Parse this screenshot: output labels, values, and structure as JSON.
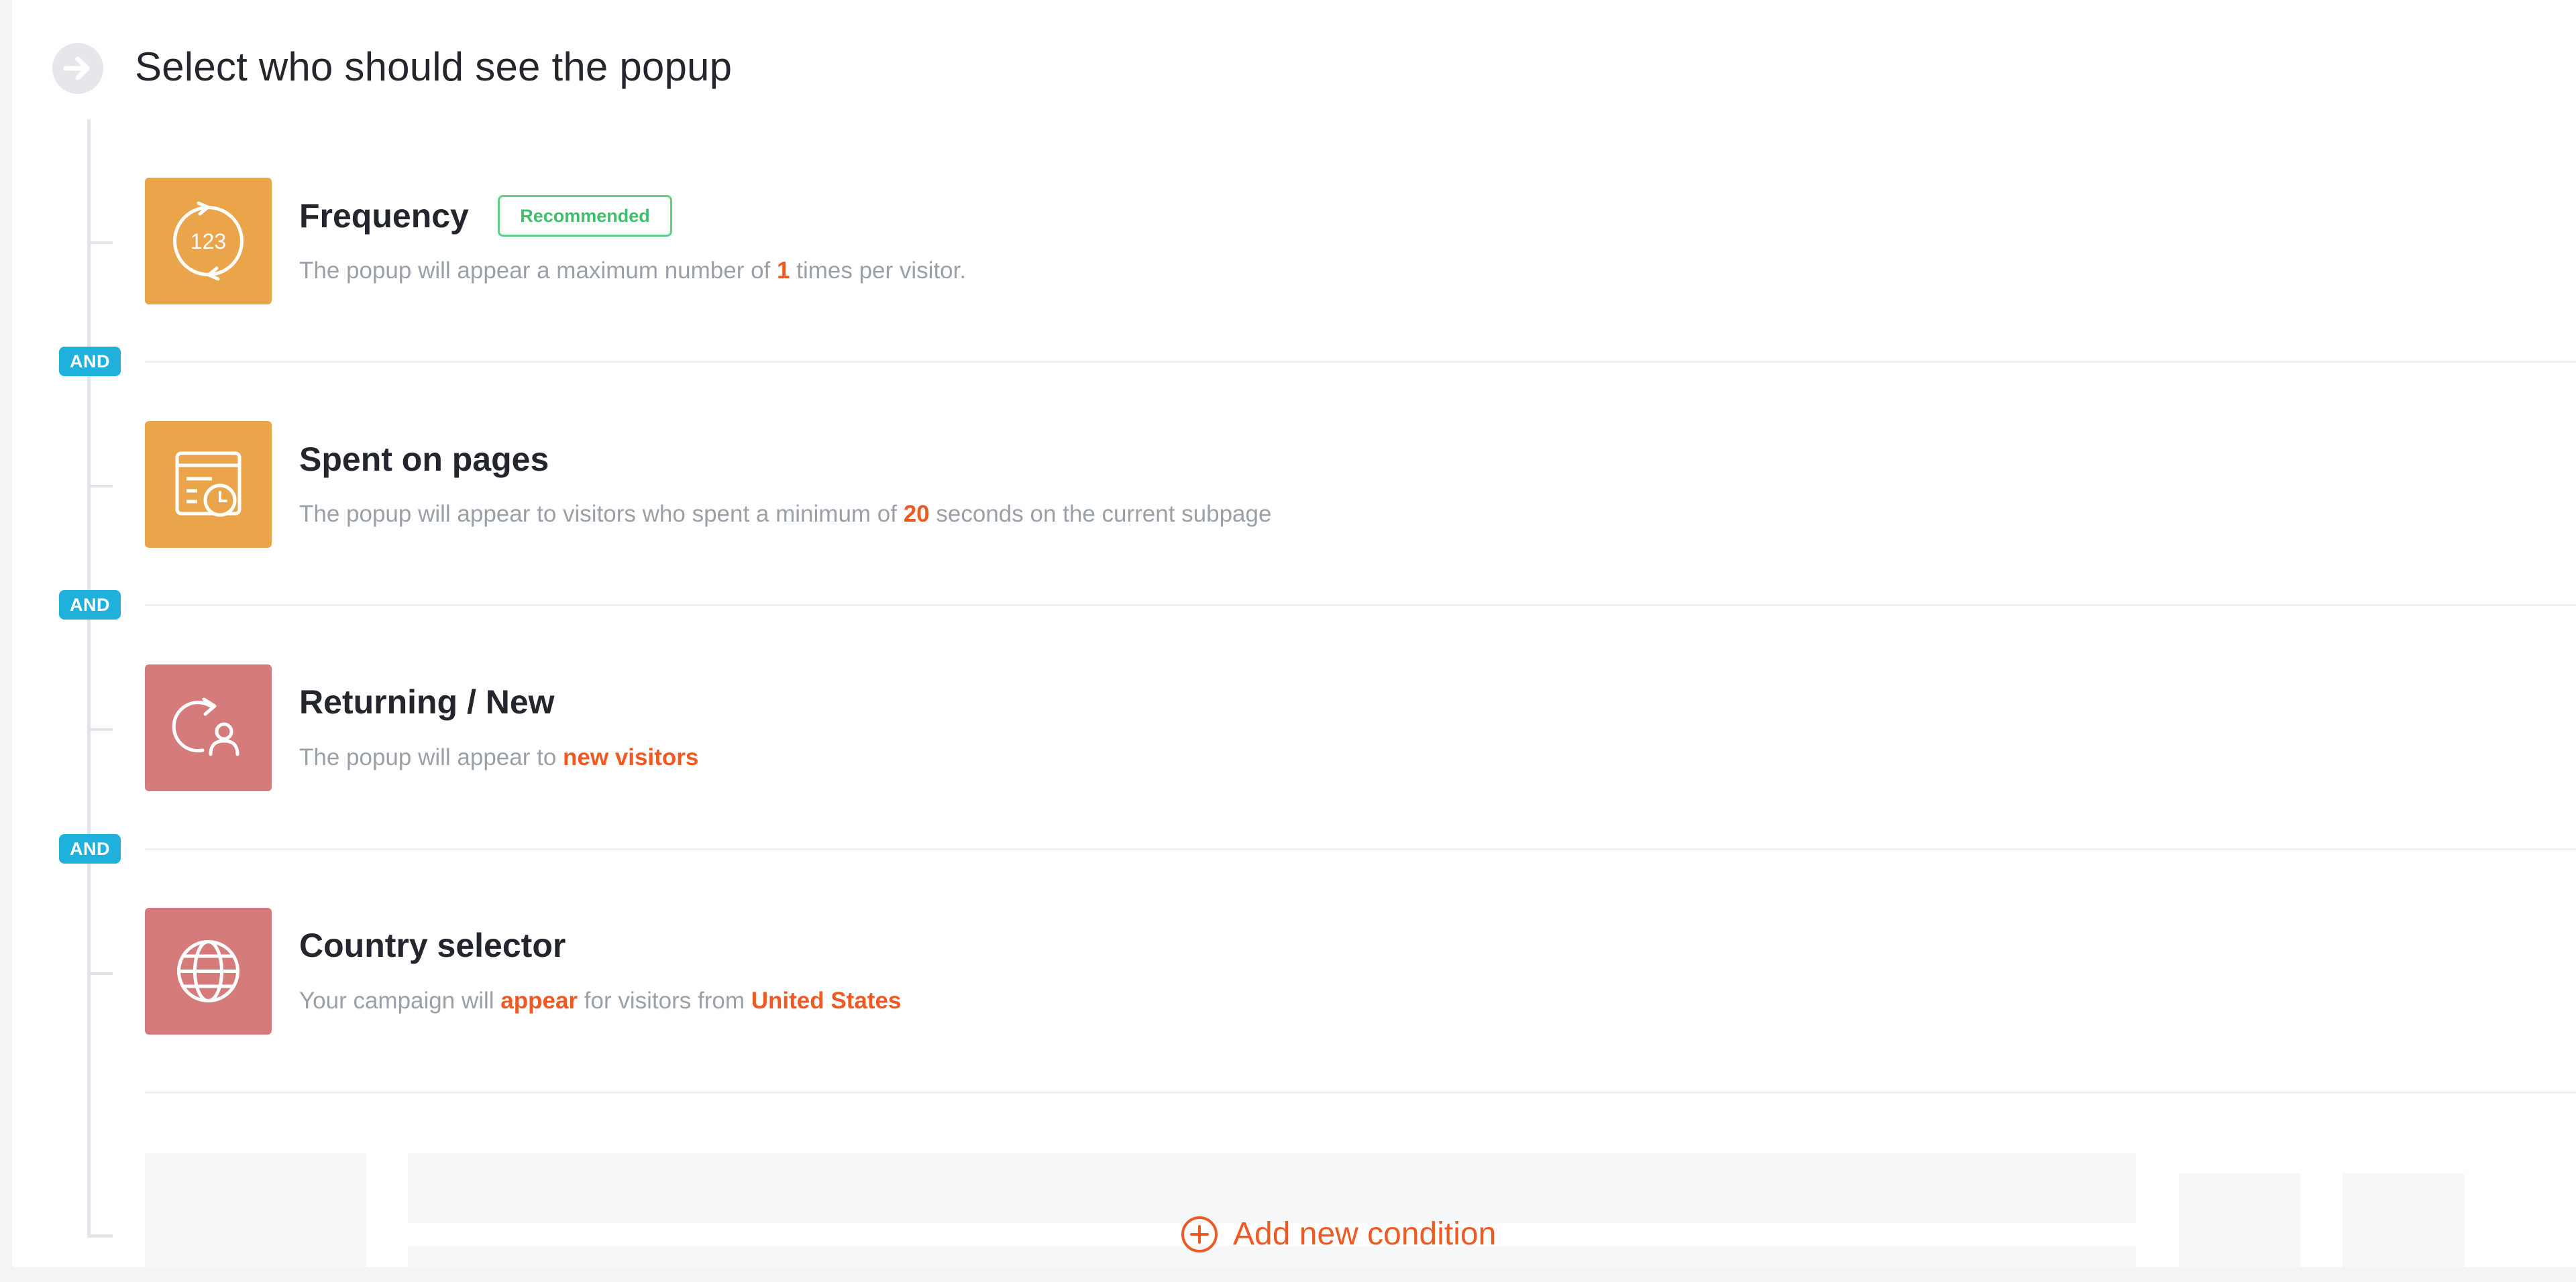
{
  "header": {
    "title": "Select who should see the popup",
    "icon": "arrow-right-circle-icon"
  },
  "operator_label": "AND",
  "conditions": [
    {
      "title": "Frequency",
      "badge": "Recommended",
      "icon": "frequency-123-icon",
      "icon_color": "#eaa54b",
      "desc_pre": "The popup will appear a maximum number of",
      "desc_value": "1",
      "desc_post": "times per visitor."
    },
    {
      "title": "Spent on pages",
      "icon": "page-timer-icon",
      "icon_color": "#eaa54b",
      "desc_pre": "The popup will appear to visitors who spent a minimum of",
      "desc_value": "20",
      "desc_post": "seconds on the current subpage"
    },
    {
      "title": "Returning / New",
      "icon": "returning-visitor-icon",
      "icon_color": "#d57b7b",
      "desc_pre": "The popup will appear to",
      "desc_value": "new visitors"
    },
    {
      "title": "Country selector",
      "icon": "globe-icon",
      "icon_color": "#d57b7b",
      "desc_pre": "Your campaign will",
      "desc_value": "appear",
      "desc_mid": "for visitors from",
      "desc_value2": "United States"
    }
  ],
  "add_condition": {
    "label": "Add new condition",
    "icon": "plus-circle-icon"
  },
  "colors": {
    "accent": "#ef5a24",
    "and_badge": "#1fb0dc",
    "recommended": "#3fbf6c"
  }
}
